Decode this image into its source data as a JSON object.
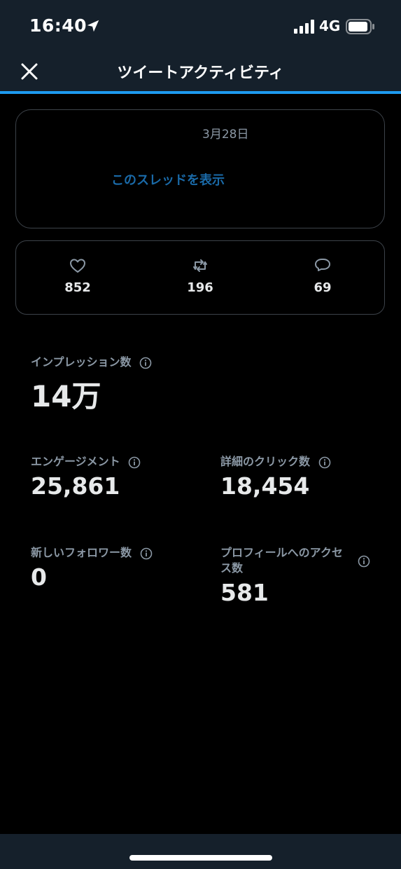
{
  "status_bar": {
    "time": "16:40",
    "network": "4G"
  },
  "header": {
    "title": "ツイートアクティビティ"
  },
  "tweet": {
    "date": "3月28日",
    "thread_link": "このスレッドを表示"
  },
  "engagement_counts": {
    "likes": "852",
    "retweets": "196",
    "replies": "69"
  },
  "metrics": {
    "impressions": {
      "label": "インプレッション数",
      "value": "14万"
    },
    "engagements": {
      "label": "エンゲージメント",
      "value": "25,861"
    },
    "detail_clicks": {
      "label": "詳細のクリック数",
      "value": "18,454"
    },
    "new_followers": {
      "label": "新しいフォロワー数",
      "value": "0"
    },
    "profile_visits": {
      "label_line1": "プロフィールへのアクセ",
      "label_line2": "ス数",
      "value": "581"
    }
  },
  "colors": {
    "accent": "#1d9bf0",
    "header_bg": "#15202b",
    "muted_text": "#8b98a5",
    "link": "#1a6aa8"
  }
}
